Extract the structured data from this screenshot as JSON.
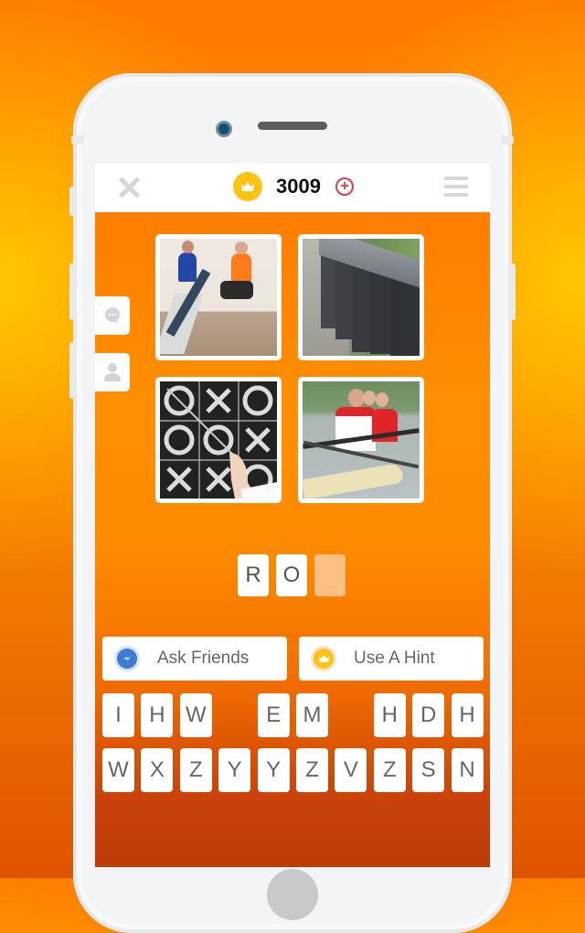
{
  "header": {
    "close_icon": "close-x-icon",
    "coin_icon": "crown-coin-icon",
    "coins": "3009",
    "add_coins_icon": "plus-circle-icon",
    "menu_icon": "hamburger-menu-icon"
  },
  "side_tabs": [
    {
      "icon": "chat-bubble-icon"
    },
    {
      "icon": "user-icon"
    }
  ],
  "puzzle": {
    "images": [
      {
        "description": "Two women exercising on rowing machines"
      },
      {
        "description": "Row of grey wheelie bins along a street"
      },
      {
        "description": "Tic-tac-toe game drawn in chalk on blackboard"
      },
      {
        "description": "Rowing team in a boat on the water"
      }
    ]
  },
  "answer": {
    "letters": [
      "R",
      "O",
      ""
    ]
  },
  "actions": {
    "ask_friends": "Ask Friends",
    "use_hint": "Use A Hint"
  },
  "keyboard": {
    "row1": [
      {
        "letter": "I",
        "col": 0
      },
      {
        "letter": "H",
        "col": 1
      },
      {
        "letter": "W",
        "col": 2
      },
      {
        "letter": "E",
        "col": 4
      },
      {
        "letter": "M",
        "col": 5
      },
      {
        "letter": "H",
        "col": 7
      },
      {
        "letter": "D",
        "col": 8
      },
      {
        "letter": "H",
        "col": 9
      }
    ],
    "row2": [
      "W",
      "X",
      "Z",
      "Y",
      "Y",
      "Z",
      "V",
      "Z",
      "S",
      "N"
    ]
  },
  "colors": {
    "coin": "#ffc20e",
    "plus": "#e33b4b",
    "messenger": "#3b7bd4",
    "empty_slot": "#ffbf82"
  }
}
